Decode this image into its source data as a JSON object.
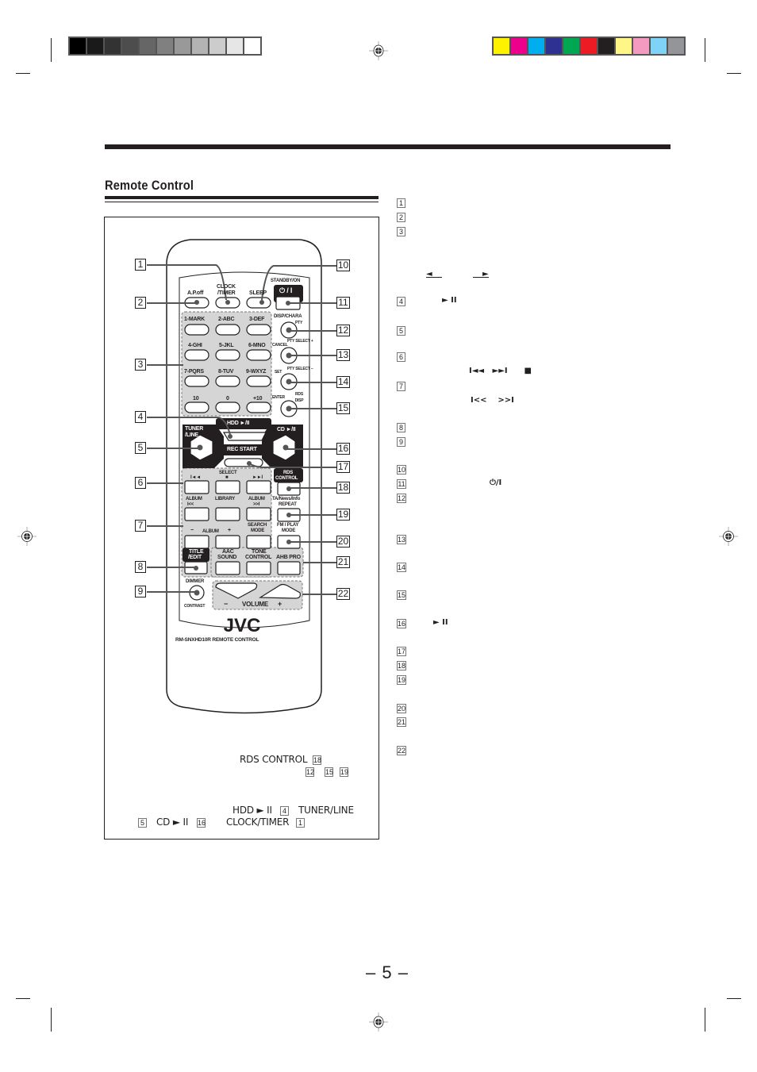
{
  "print_marks": {
    "grayscale_swatches": [
      "#000000",
      "#1a1a1a",
      "#333333",
      "#4d4d4d",
      "#666666",
      "#808080",
      "#999999",
      "#b3b3b3",
      "#cccccc",
      "#e6e6e6",
      "#ffffff"
    ],
    "color_swatches": [
      "#fff200",
      "#ec008c",
      "#00aeef",
      "#2e3192",
      "#00a651",
      "#ed1c24",
      "#231f20",
      "#fff685",
      "#f49ac1",
      "#7fd3f7",
      "#939598"
    ]
  },
  "section": {
    "title": "Remote Control"
  },
  "remote": {
    "brand": "JVC",
    "model": "RM-SNXHD10R  REMOTE CONTROL",
    "buttons": {
      "ap_off": "A.P.off",
      "clock_timer_1": "CLOCK",
      "clock_timer_2": "/TIMER",
      "sleep": "SLEEP",
      "standby_on": "STANDBY/ON",
      "standby_symbol": "⏻ / I",
      "mark1": "1-MARK",
      "abc2": "2-ABC",
      "def3": "3-DEF",
      "ghi4": "4-GHI",
      "jkl5": "5-JKL",
      "mno6": "6-MNO",
      "pqrs7": "7-PQRS",
      "tuv8": "8-TUV",
      "wxyz9": "9-WXYZ",
      "ten": "10",
      "zero": "0",
      "plus10": "+10",
      "disp_chara": "DISP/CHARA",
      "pty": "PTY",
      "cancel": "CANCEL",
      "pty_select_plus": "PTY SELECT +",
      "set": "SET",
      "pty_select_minus": "PTY SELECT −",
      "enter": "ENTER",
      "rds_disp": "RDS DISP",
      "hdd": "HDD ►/II",
      "tuner_line_1": "TUNER",
      "tuner_line_2": "/LINE",
      "cd": "CD ►/II",
      "rec_start": "REC START",
      "select": "SELECT",
      "prev": "I◄◄",
      "stop": "■",
      "next": "►►I",
      "rds_control_1": "RDS",
      "rds_control_2": "CONTROL",
      "album_prev_1": "ALBUM",
      "album_prev_2": "I<<",
      "library": "LIBRARY",
      "album_next_1": "ALBUM",
      "album_next_2": ">>I",
      "ta_news_info": "TA/News/Info",
      "repeat": "REPEAT",
      "album_minus": "−",
      "album_label": "ALBUM",
      "album_plus": "+",
      "search_mode_1": "SEARCH",
      "search_mode_2": "MODE",
      "fm_play_1": "FM / PLAY",
      "fm_play_2": "MODE",
      "title_edit_1": "TITLE",
      "title_edit_2": "/EDIT",
      "aac_1": "AAC",
      "aac_2": "SOUND",
      "tone_1": "TONE",
      "tone_2": "CONTROL",
      "ahb_pro": "AHB PRO",
      "dimmer": "DIMMER",
      "contrast": "CONTRAST",
      "volume_minus": "−",
      "volume_label": "VOLUME",
      "volume_plus": "+"
    }
  },
  "callouts_left": [
    "1",
    "2",
    "3",
    "4",
    "5",
    "6",
    "7",
    "8",
    "9"
  ],
  "callouts_right": [
    "10",
    "11",
    "12",
    "13",
    "14",
    "15",
    "16",
    "17",
    "18",
    "19",
    "20",
    "21",
    "22"
  ],
  "item_list": [
    {
      "num": "1"
    },
    {
      "num": "2"
    },
    {
      "num": "3"
    },
    {
      "num": "4",
      "glyph": "► II"
    },
    {
      "num": "5"
    },
    {
      "num": "6",
      "glyph": "I◄◄   ►►I      ■"
    },
    {
      "num": "7",
      "glyph": "I<<    >>I"
    },
    {
      "num": "8"
    },
    {
      "num": "9"
    },
    {
      "num": "10"
    },
    {
      "num": "11",
      "glyph": "⏻/I"
    },
    {
      "num": "12"
    },
    {
      "num": "13"
    },
    {
      "num": "14"
    },
    {
      "num": "15"
    },
    {
      "num": "16",
      "glyph": "► II"
    },
    {
      "num": "17"
    },
    {
      "num": "18"
    },
    {
      "num": "19"
    },
    {
      "num": "20"
    },
    {
      "num": "21"
    },
    {
      "num": "22"
    }
  ],
  "item3_arrows": {
    "left": "◄",
    "right": "►"
  },
  "figure_notes": {
    "rds_control": "RDS CONTROL",
    "rds_ref": "18",
    "refs_line": [
      "12",
      "15",
      "19"
    ],
    "hdd": "HDD ► II",
    "hdd_ref": "4",
    "tuner_line": "TUNER/LINE",
    "tuner_ref": "5",
    "cd": "CD ► II",
    "cd_ref": "16",
    "clock_timer": "CLOCK/TIMER",
    "clock_ref": "1"
  },
  "page_number": "– 5 –"
}
